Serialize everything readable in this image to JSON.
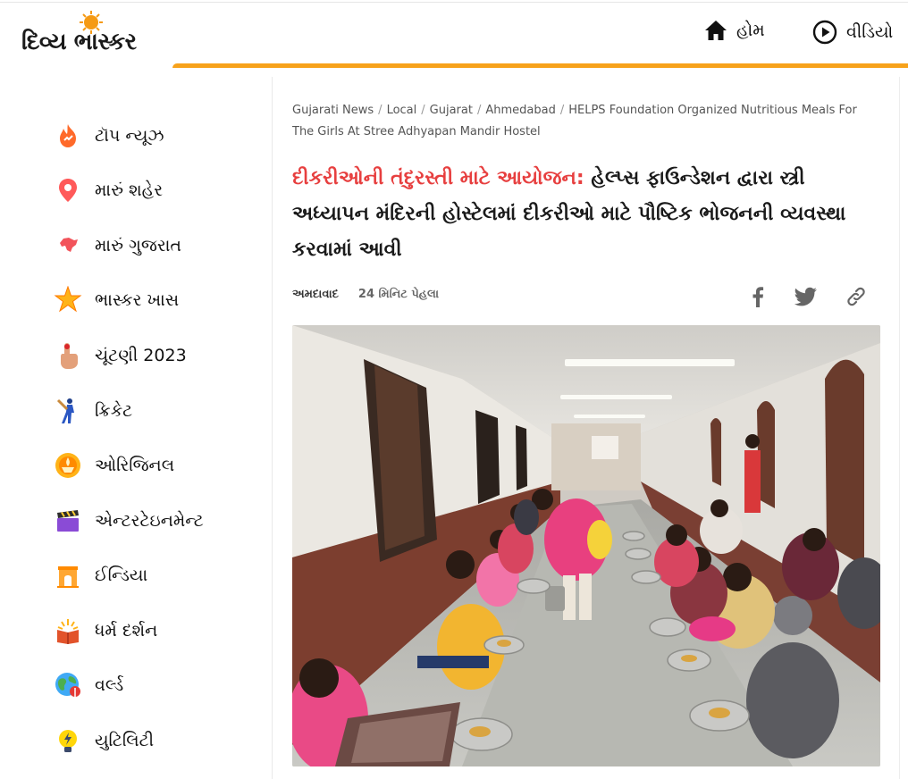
{
  "header": {
    "logo_text": "દિવ્ય ભાસ્કર",
    "nav": [
      {
        "label": "હોમ",
        "icon": "home-icon"
      },
      {
        "label": "વીડિયો",
        "icon": "play-icon"
      }
    ],
    "accent_color": "#f7a21b"
  },
  "sidebar": {
    "items": [
      {
        "label": "ટૉપ ન્યૂઝ",
        "icon": "fire-icon"
      },
      {
        "label": "મારું શહેર",
        "icon": "location-pin-icon"
      },
      {
        "label": "મારું ગુજરાત",
        "icon": "gujarat-map-icon"
      },
      {
        "label": "ભાસ્કર ખાસ",
        "icon": "star-icon"
      },
      {
        "label": "ચૂંટણી 2023",
        "icon": "voting-finger-icon"
      },
      {
        "label": "ક્રિકેટ",
        "icon": "cricket-player-icon"
      },
      {
        "label": "ઓરિજિનલ",
        "icon": "diya-lamp-icon"
      },
      {
        "label": "એન્ટરટેઇનમેન્ટ",
        "icon": "clapperboard-icon"
      },
      {
        "label": "ઈન્ડિયા",
        "icon": "india-gate-icon"
      },
      {
        "label": "ધર્મ દર્શન",
        "icon": "holy-book-icon"
      },
      {
        "label": "વર્લ્ડ",
        "icon": "globe-icon"
      },
      {
        "label": "યુટિલિટી",
        "icon": "lightbulb-icon"
      }
    ]
  },
  "article": {
    "breadcrumb": [
      "Gujarati News",
      "Local",
      "Gujarat",
      "Ahmedabad",
      "HELPS Foundation Organized Nutritious Meals For The Girls At Stree Adhyapan Mandir Hostel"
    ],
    "headline_highlight": "દીકરીઓની તંદુરસ્તી માટે આયોજન:",
    "headline_rest": " હેલ્પ્સ ફાઉન્ડેશન દ્વારા સ્ત્રી અધ્યાપન મંદિરની હોસ્ટેલમાં દીકરીઓ માટે પૌષ્ટિક ભોજનની વ્યવસ્થા કરવામાં આવી",
    "highlight_color": "#e73f3f",
    "location": "અમદાવાદ",
    "time": "24 મિનિટ પેહલા",
    "share": [
      "facebook-icon",
      "twitter-icon",
      "link-icon"
    ]
  }
}
